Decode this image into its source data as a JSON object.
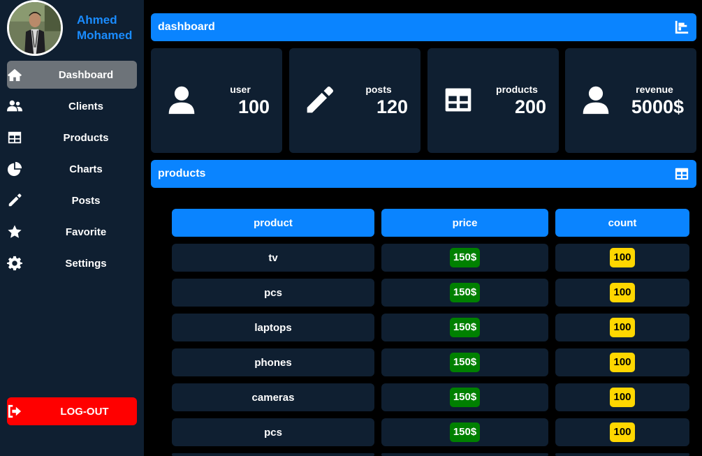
{
  "profile": {
    "name": "Ahmed Mohamed"
  },
  "nav": {
    "items": [
      {
        "label": "Dashboard",
        "icon": "home-icon",
        "active": true
      },
      {
        "label": "Clients",
        "icon": "users-icon",
        "active": false
      },
      {
        "label": "Products",
        "icon": "table-icon",
        "active": false
      },
      {
        "label": "Charts",
        "icon": "pie-chart-icon",
        "active": false
      },
      {
        "label": "Posts",
        "icon": "pencil-icon",
        "active": false
      },
      {
        "label": "Favorite",
        "icon": "star-icon",
        "active": false
      },
      {
        "label": "Settings",
        "icon": "gear-icon",
        "active": false
      }
    ],
    "logout_label": "LOG-OUT"
  },
  "dashboard_bar": {
    "title": "dashboard",
    "icon": "bar-chart-icon"
  },
  "cards": [
    {
      "label": "user",
      "value": "100",
      "icon": "user-icon"
    },
    {
      "label": "posts",
      "value": "120",
      "icon": "pencil-icon"
    },
    {
      "label": "products",
      "value": "200",
      "icon": "table-icon"
    },
    {
      "label": "revenue",
      "value": "5000$",
      "icon": "user-icon"
    }
  ],
  "products_bar": {
    "title": "products",
    "icon": "table-icon"
  },
  "table": {
    "headers": {
      "product": "product",
      "price": "price",
      "count": "count"
    },
    "rows": [
      {
        "product": "tv",
        "price": "150$",
        "count": "100"
      },
      {
        "product": "pcs",
        "price": "150$",
        "count": "100"
      },
      {
        "product": "laptops",
        "price": "150$",
        "count": "100"
      },
      {
        "product": "phones",
        "price": "150$",
        "count": "100"
      },
      {
        "product": "cameras",
        "price": "150$",
        "count": "100"
      },
      {
        "product": "pcs",
        "price": "150$",
        "count": "100"
      }
    ]
  },
  "colors": {
    "accent": "#0a84ff",
    "panel": "#0f1f31",
    "logout": "#ff0000",
    "price_badge": "#008000",
    "count_badge": "#ffd700"
  }
}
